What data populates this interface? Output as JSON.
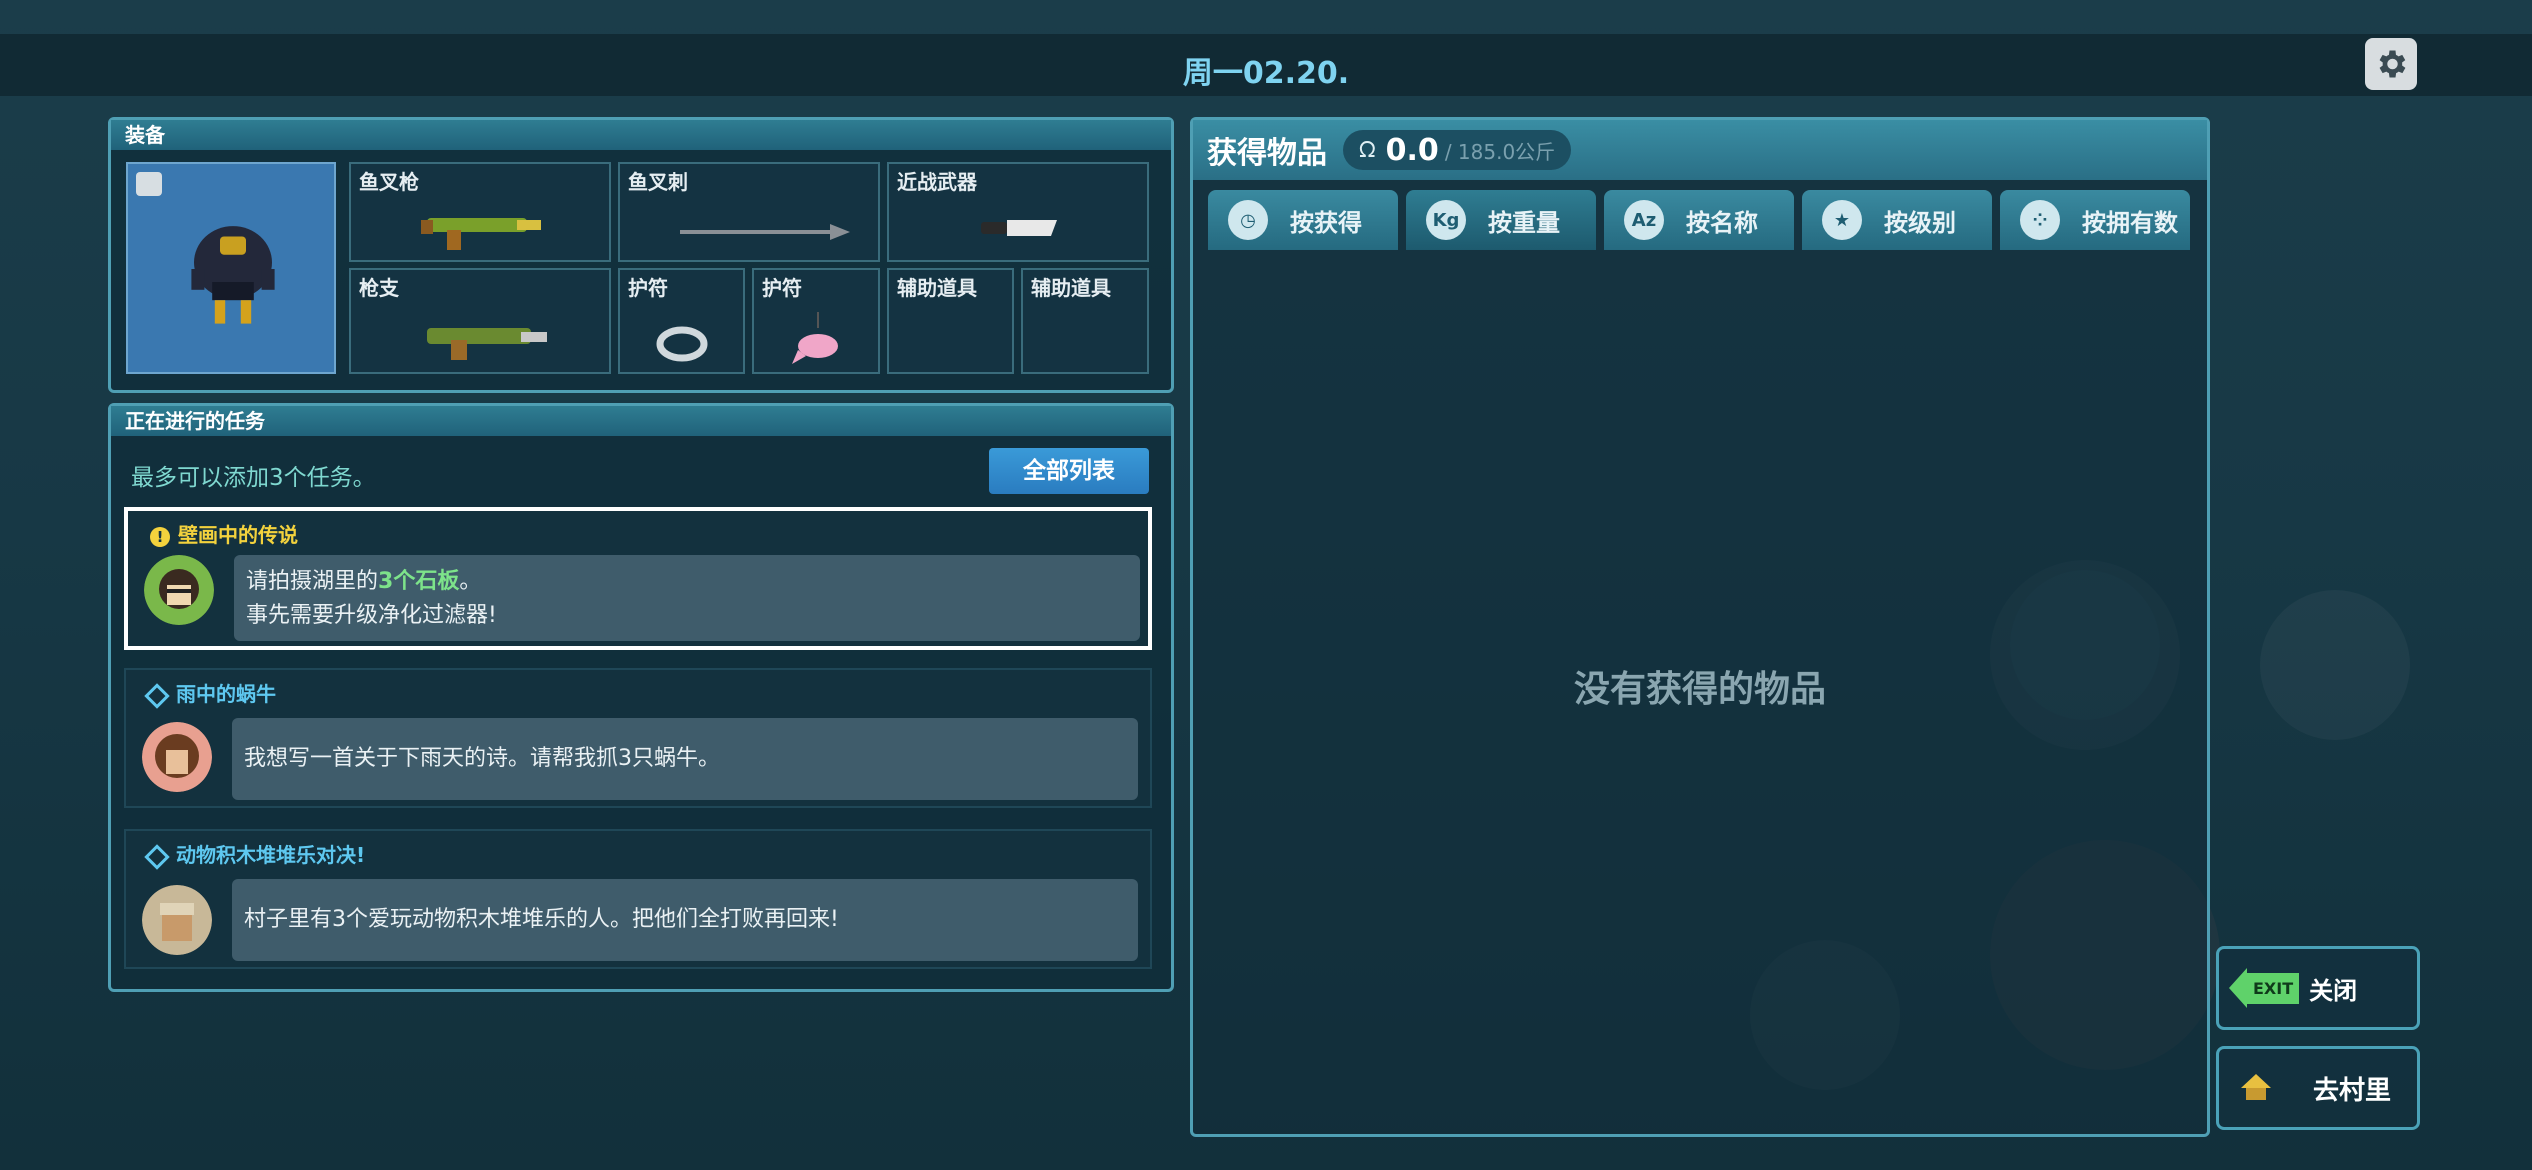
{
  "header": {
    "date": "周一02.20."
  },
  "equipment": {
    "title": "装备",
    "slots": [
      "鱼叉枪",
      "鱼叉刺",
      "近战武器",
      "枪支",
      "护符",
      "护符",
      "辅助道具",
      "辅助道具"
    ]
  },
  "quests": {
    "title": "正在进行的任务",
    "hint": "最多可以添加3个任务。",
    "list_button": "全部列表",
    "items": [
      {
        "title": "壁画中的传说",
        "line1_pre": "请拍摄湖里的",
        "line1_highlight": "3个石板",
        "line1_post": "。",
        "line2": "事先需要升级净化过滤器!"
      },
      {
        "title": "雨中的蜗牛",
        "text": "我想写一首关于下雨天的诗。请帮我抓3只蜗牛。"
      },
      {
        "title": "动物积木堆堆乐对决!",
        "text": "村子里有3个爱玩动物积木堆堆乐的人。把他们全打败再回来!"
      }
    ]
  },
  "inventory": {
    "title": "获得物品",
    "weight": "0.0",
    "capacity": "/ 185.0公斤",
    "empty_text": "没有获得的物品",
    "tabs": [
      {
        "icon": "clock-icon",
        "label": "按获得"
      },
      {
        "icon": "kg-icon",
        "label": "按重量",
        "glyph": "Kg"
      },
      {
        "icon": "az-icon",
        "label": "按名称",
        "glyph": "Az"
      },
      {
        "icon": "star-icon",
        "label": "按级别"
      },
      {
        "icon": "dots-icon",
        "label": "按拥有数"
      }
    ]
  },
  "buttons": {
    "exit_badge": "EXIT",
    "close": "关闭",
    "village": "去村里"
  },
  "colors": {
    "accent": "#4f9fb4",
    "highlight": "#7de38a",
    "date": "#7fd3f0",
    "quest_active": "#f3d23d",
    "quest_pending": "#5ec8f0"
  }
}
